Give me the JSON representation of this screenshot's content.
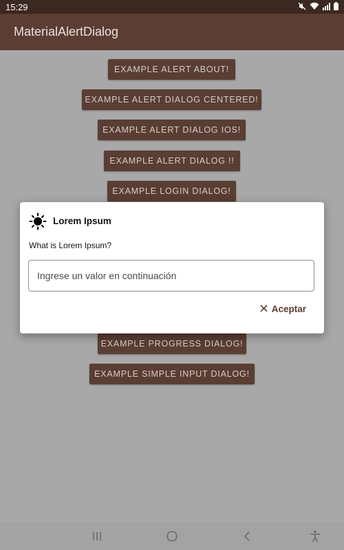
{
  "status_bar": {
    "time": "15:29",
    "icons": [
      "mute-icon",
      "wifi-icon",
      "signal-icon",
      "battery-icon"
    ]
  },
  "app_bar": {
    "title": "MaterialAlertDialog"
  },
  "buttons": [
    {
      "label": "EXAMPLE ALERT ABOUT!"
    },
    {
      "label": "EXAMPLE ALERT DIALOG CENTERED!"
    },
    {
      "label": "EXAMPLE ALERT DIALOG IOS!"
    },
    {
      "label": "EXAMPLE ALERT DIALOG !!"
    },
    {
      "label": "EXAMPLE LOGIN DIALOG!"
    },
    {
      "label": "EXAMPLE PROGRESS DIALOG!"
    },
    {
      "label": "EXAMPLE SIMPLE INPUT DIALOG!"
    }
  ],
  "dialog": {
    "icon": "sun-icon",
    "title": "Lorem Ipsum",
    "message": "What is Lorem Ipsum?",
    "input_placeholder": "Ingrese un valor en continuación",
    "input_value": "",
    "action_icon": "close-icon",
    "action_label": "Aceptar"
  },
  "nav_bar": {
    "icons": [
      "recent-apps-icon",
      "home-icon",
      "back-icon",
      "accessibility-icon"
    ]
  },
  "colors": {
    "primary_dark": "#3b2820",
    "primary": "#5c3d33",
    "button_text": "#d6cdc9",
    "scrim": "#a8a8a8"
  }
}
